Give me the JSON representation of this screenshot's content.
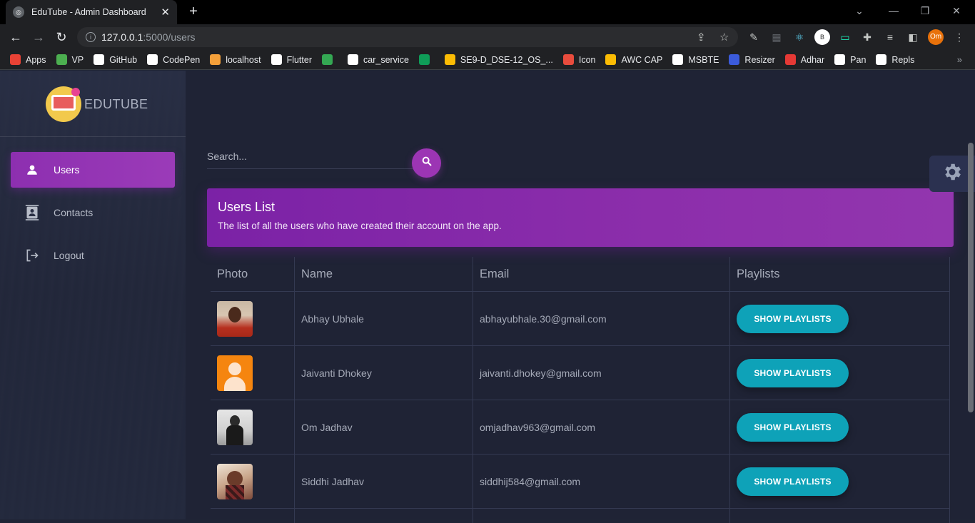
{
  "browser": {
    "tab_title": "EduTube - Admin Dashboard",
    "url_host": "127.0.0.1",
    "url_path": ":5000/users",
    "profile_initials": "Om",
    "ext_initial": "B",
    "bookmarks": [
      {
        "label": "Apps",
        "color": "#e94235"
      },
      {
        "label": "VP",
        "color": "#4caf50"
      },
      {
        "label": "GitHub",
        "color": "#ffffff"
      },
      {
        "label": "CodePen",
        "color": "#ffffff"
      },
      {
        "label": "localhost",
        "color": "#f4a03a"
      },
      {
        "label": "Flutter",
        "color": "#ffffff"
      },
      {
        "label": "",
        "color": "#34a853"
      },
      {
        "label": "car_service",
        "color": "#ffffff"
      },
      {
        "label": "",
        "color": "#0f9d58"
      },
      {
        "label": "SE9-D_DSE-12_OS_...",
        "color": "#fbbc04"
      },
      {
        "label": "Icon",
        "color": "#e84c3d"
      },
      {
        "label": "AWC CAP",
        "color": "#fbbc04"
      },
      {
        "label": "MSBTE",
        "color": "#ffffff"
      },
      {
        "label": "Resizer",
        "color": "#3b5bdb"
      },
      {
        "label": "Adhar",
        "color": "#e53935"
      },
      {
        "label": "Pan",
        "color": "#ffffff"
      },
      {
        "label": "Repls",
        "color": "#ffffff"
      }
    ],
    "bookmarks_more": "»"
  },
  "sidebar": {
    "brand": "EDUTUBE",
    "items": [
      {
        "label": "Users",
        "icon": "person-icon",
        "active": true
      },
      {
        "label": "Contacts",
        "icon": "contact-card-icon",
        "active": false
      },
      {
        "label": "Logout",
        "icon": "logout-icon",
        "active": false
      }
    ]
  },
  "main": {
    "search_placeholder": "Search...",
    "card_title": "Users List",
    "card_subtitle": "The list of all the users who have created their account on the app.",
    "table": {
      "headers": [
        "Photo",
        "Name",
        "Email",
        "Playlists"
      ],
      "button_label": "SHOW PLAYLISTS",
      "rows": [
        {
          "name": "Abhay Ubhale",
          "email": "abhayubhale.30@gmail.com",
          "avatar": "photo-red-shirt"
        },
        {
          "name": "Jaivanti Dhokey",
          "email": "jaivanti.dhokey@gmail.com",
          "avatar": "default-orange"
        },
        {
          "name": "Om Jadhav",
          "email": "omjadhav963@gmail.com",
          "avatar": "photo-monochrome"
        },
        {
          "name": "Siddhi Jadhav",
          "email": "siddhij584@gmail.com",
          "avatar": "photo-warm"
        }
      ]
    }
  },
  "colors": {
    "accent": "#9c35b4",
    "button": "#0ea2b8",
    "background": "#1f2335"
  }
}
